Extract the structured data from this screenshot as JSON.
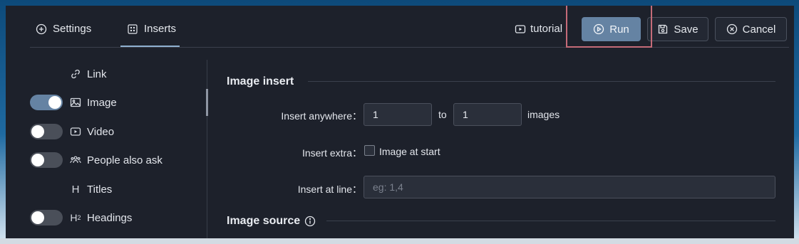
{
  "tabs": [
    {
      "label": "Settings",
      "icon": "plus-circle-icon"
    },
    {
      "label": "Inserts",
      "icon": "dotted-square-icon",
      "active": true
    }
  ],
  "toolbar": {
    "tutorial_label": "tutorial",
    "run_label": "Run",
    "save_label": "Save",
    "cancel_label": "Cancel"
  },
  "sidebar": {
    "items": [
      {
        "label": "Link",
        "icon": "link-icon",
        "toggle": null
      },
      {
        "label": "Image",
        "icon": "image-icon",
        "toggle": true
      },
      {
        "label": "Video",
        "icon": "video-icon",
        "toggle": false
      },
      {
        "label": "People also ask",
        "icon": "people-icon",
        "toggle": false
      },
      {
        "label": "Titles",
        "icon": "heading-h-icon",
        "toggle": null
      },
      {
        "label": "Headings",
        "icon": "heading-h2-icon",
        "toggle": false
      }
    ]
  },
  "image_insert": {
    "section_title": "Image insert",
    "anywhere_label": "Insert anywhere：",
    "from_value": "1",
    "to_label": "to",
    "to_value": "1",
    "images_label": "images",
    "extra_label": "Insert extra：",
    "image_at_start_label": "Image at start",
    "image_at_start_checked": false,
    "at_line_label": "Insert at line：",
    "at_line_placeholder": "eg: 1,4",
    "at_line_value": ""
  },
  "image_source": {
    "section_title": "Image source",
    "info_icon": "info-icon"
  },
  "colors": {
    "panel_bg": "#1d212b",
    "accent": "#6583a3",
    "highlight": "#c56b78"
  }
}
